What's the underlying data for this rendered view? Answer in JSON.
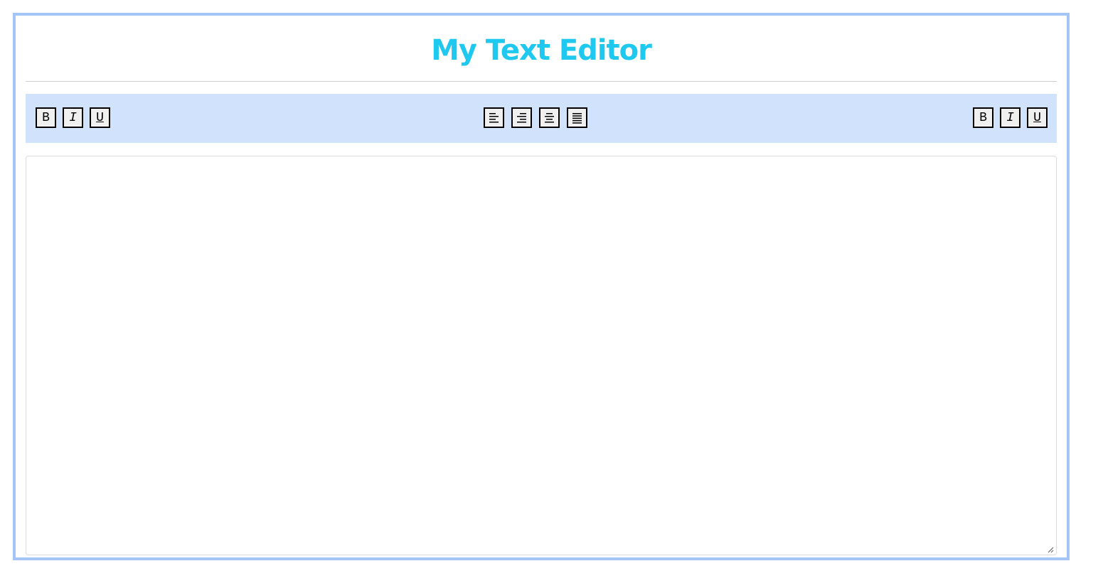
{
  "app": {
    "title": "My Text Editor",
    "title_color": "#1ec8ee"
  },
  "toolbar": {
    "background": "#d1e2fd",
    "left_group": [
      {
        "label": "B",
        "icon": "bold-icon"
      },
      {
        "label": "I",
        "icon": "italic-icon"
      },
      {
        "label": "U",
        "icon": "underline-icon"
      }
    ],
    "center_group": [
      {
        "icon": "align-left-icon"
      },
      {
        "icon": "align-right-icon"
      },
      {
        "icon": "align-center-icon"
      },
      {
        "icon": "align-justify-icon"
      }
    ],
    "right_group": [
      {
        "label": "B",
        "icon": "bold-icon"
      },
      {
        "label": "I",
        "icon": "italic-icon"
      },
      {
        "label": "U",
        "icon": "underline-icon"
      }
    ]
  },
  "editor": {
    "value": "",
    "placeholder": ""
  },
  "colors": {
    "frame_border": "#a3c6f7"
  }
}
